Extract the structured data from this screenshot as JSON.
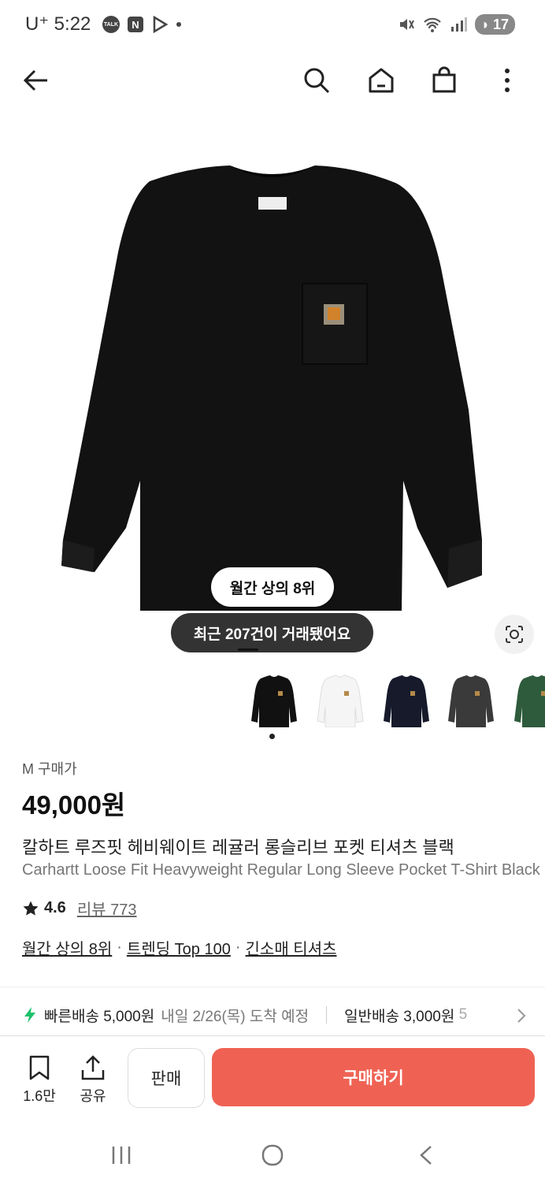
{
  "status_bar": {
    "carrier": "U⁺",
    "time": "5:22",
    "talk_label": "TALK",
    "n_label": "N",
    "battery": "17"
  },
  "topbar": {
    "back_icon": "arrow-left-icon",
    "search_icon": "search-icon",
    "home_icon": "home-icon",
    "bag_icon": "shopping-bag-icon",
    "more_icon": "more-vertical-icon"
  },
  "hero": {
    "rank_badge": "월간 상의 8위",
    "trade_badge": "최근 207건이 거래됐어요"
  },
  "thumbnails": [
    {
      "color": "#111111",
      "name": "black"
    },
    {
      "color": "#f5f5f5",
      "name": "white"
    },
    {
      "color": "#161a2b",
      "name": "navy"
    },
    {
      "color": "#3a3a3a",
      "name": "charcoal"
    },
    {
      "color": "#2e5b3c",
      "name": "green"
    }
  ],
  "product": {
    "price_label": "M 구매가",
    "price": "49,000원",
    "name_ko": "칼하트 루즈핏 헤비웨이트 레귤러 롱슬리브 포켓 티셔츠 블랙",
    "name_en": "Carhartt Loose Fit Heavyweight Regular Long Sleeve Pocket T-Shirt Black",
    "rating": "4.6",
    "review": "리뷰 773",
    "tags": [
      "월간 상의 8위",
      "트렌딩 Top 100",
      "긴소매 티셔츠"
    ],
    "tag_sep": "·"
  },
  "shipping": {
    "fast_label": "빠른배송 5,000원",
    "fast_eta": "내일 2/26(목) 도착 예정",
    "normal_label": "일반배송 3,000원",
    "normal_price_tail": "5"
  },
  "actions": {
    "bookmark_count": "1.6만",
    "share_label": "공유",
    "sell_label": "판매",
    "buy_label": "구매하기"
  },
  "colors": {
    "buy_button": "#ef6253",
    "fast_shipping_icon": "#1fc16b"
  }
}
